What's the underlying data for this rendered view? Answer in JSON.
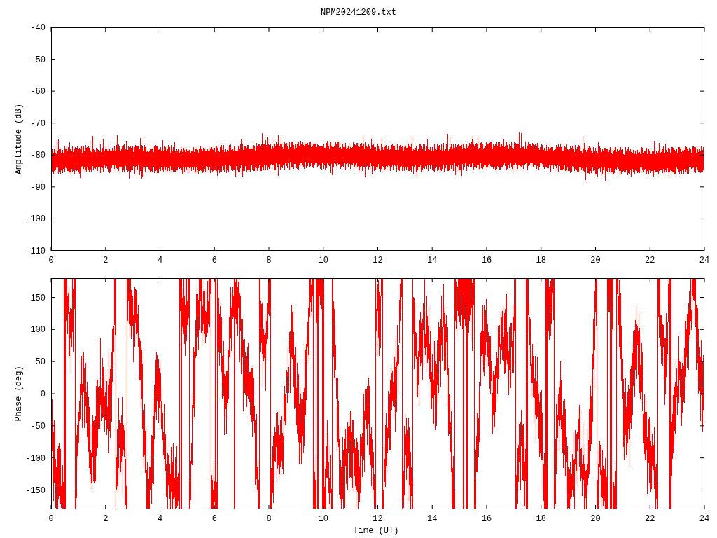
{
  "title": "NPM20241209.txt",
  "amplitude_plot": {
    "y_axis_title": "Amplitude (dB)",
    "y_tick_labels": [
      "-40",
      "-50",
      "-60",
      "-70",
      "-80",
      "-90",
      "-100",
      "-110"
    ],
    "x_tick_labels": [
      "0",
      "2",
      "4",
      "6",
      "8",
      "10",
      "12",
      "14",
      "16",
      "18",
      "20",
      "22",
      "24"
    ]
  },
  "phase_plot": {
    "y_axis_title": "Phase (deg)",
    "y_tick_labels": [
      "150",
      "100",
      "50",
      "0",
      "-50",
      "-100",
      "-150"
    ],
    "x_tick_labels": [
      "0",
      "2",
      "4",
      "6",
      "8",
      "10",
      "12",
      "14",
      "16",
      "18",
      "20",
      "22",
      "24"
    ],
    "x_axis_title": "Time (UT)"
  }
}
